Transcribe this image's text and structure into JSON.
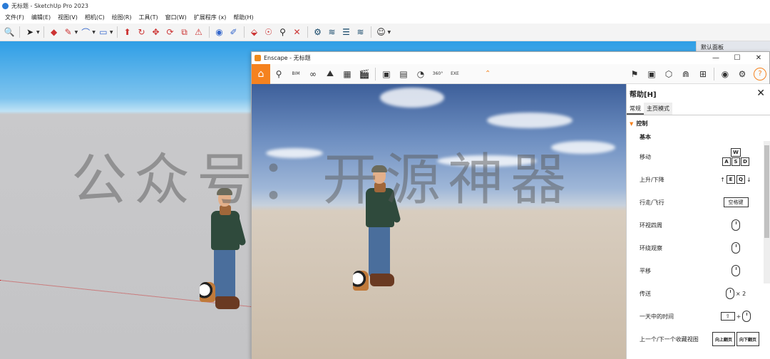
{
  "sketchup": {
    "title": "无标题 - SketchUp Pro 2023",
    "menu": [
      "文件(F)",
      "编辑(E)",
      "视图(V)",
      "相机(C)",
      "绘图(R)",
      "工具(T)",
      "窗口(W)",
      "扩展程序 (x)",
      "帮助(H)"
    ],
    "right_panel_title": "默认面板"
  },
  "watermark": "公众号：开源神器",
  "enscape": {
    "title": "Enscape - 无标题",
    "toolbar_bim": "BIM",
    "toolbar_360": "360°",
    "toolbar_exe": "EXE"
  },
  "help": {
    "title": "帮助[H]",
    "close": "✕",
    "tabs": [
      "常规",
      "主页模式"
    ],
    "section": "控制",
    "subsection": "基本",
    "rows": [
      {
        "label": "移动",
        "keys": [
          "W",
          "A",
          "S",
          "D"
        ]
      },
      {
        "label": "上升/下降",
        "keys": [
          "E",
          "Q"
        ]
      },
      {
        "label": "行走/飞行",
        "keys": [
          "空格键"
        ]
      },
      {
        "label": "环视四周",
        "keys": []
      },
      {
        "label": "环绕观察",
        "keys": []
      },
      {
        "label": "平移",
        "keys": []
      },
      {
        "label": "传送",
        "keys": [
          "× 2"
        ]
      },
      {
        "label": "一天中的时间",
        "keys": [
          "+"
        ]
      },
      {
        "label": "上一个/下一个收藏视图",
        "keys": [
          "向上翻页",
          "向下翻页"
        ]
      }
    ]
  },
  "colors": {
    "accent": "#f5821f",
    "sky": "#2e9ee6"
  }
}
